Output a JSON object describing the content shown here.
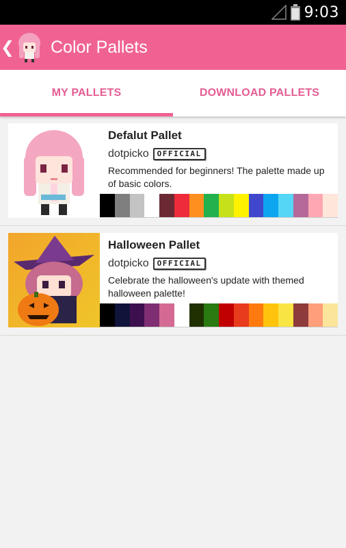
{
  "status_bar": {
    "time": "9:03"
  },
  "app_bar": {
    "title": "Color Pallets"
  },
  "tabs": [
    {
      "label": "MY PALLETS",
      "active": true
    },
    {
      "label": "DOWNLOAD PALLETS",
      "active": false
    }
  ],
  "pallets": [
    {
      "name": "Defalut Pallet",
      "author": "dotpicko",
      "badge": "OFFICIAL",
      "description": "Recommended for beginners! The palette made up of basic colors.",
      "colors": [
        "#000000",
        "#7f7f7f",
        "#c3c3c3",
        "#ffffff",
        "#6b2a33",
        "#ee2b3b",
        "#ff8f1f",
        "#22b14c",
        "#c6e11a",
        "#fff200",
        "#3f48cc",
        "#0ea5f0",
        "#54d6f6",
        "#b4699a",
        "#ffa7b3",
        "#ffe6da"
      ]
    },
    {
      "name": "Halloween Pallet",
      "author": "dotpicko",
      "badge": "OFFICIAL",
      "description": "Celebrate the halloween's update with themed halloween palette!",
      "colors": [
        "#000000",
        "#10143a",
        "#3d0f4e",
        "#802e73",
        "#d46a94",
        "#ffffff",
        "#203000",
        "#2a7a12",
        "#c00000",
        "#e83a1c",
        "#ff7a0e",
        "#ffc30e",
        "#f8e443",
        "#8e3b3b",
        "#ff9e7a",
        "#fbe59a"
      ]
    }
  ]
}
